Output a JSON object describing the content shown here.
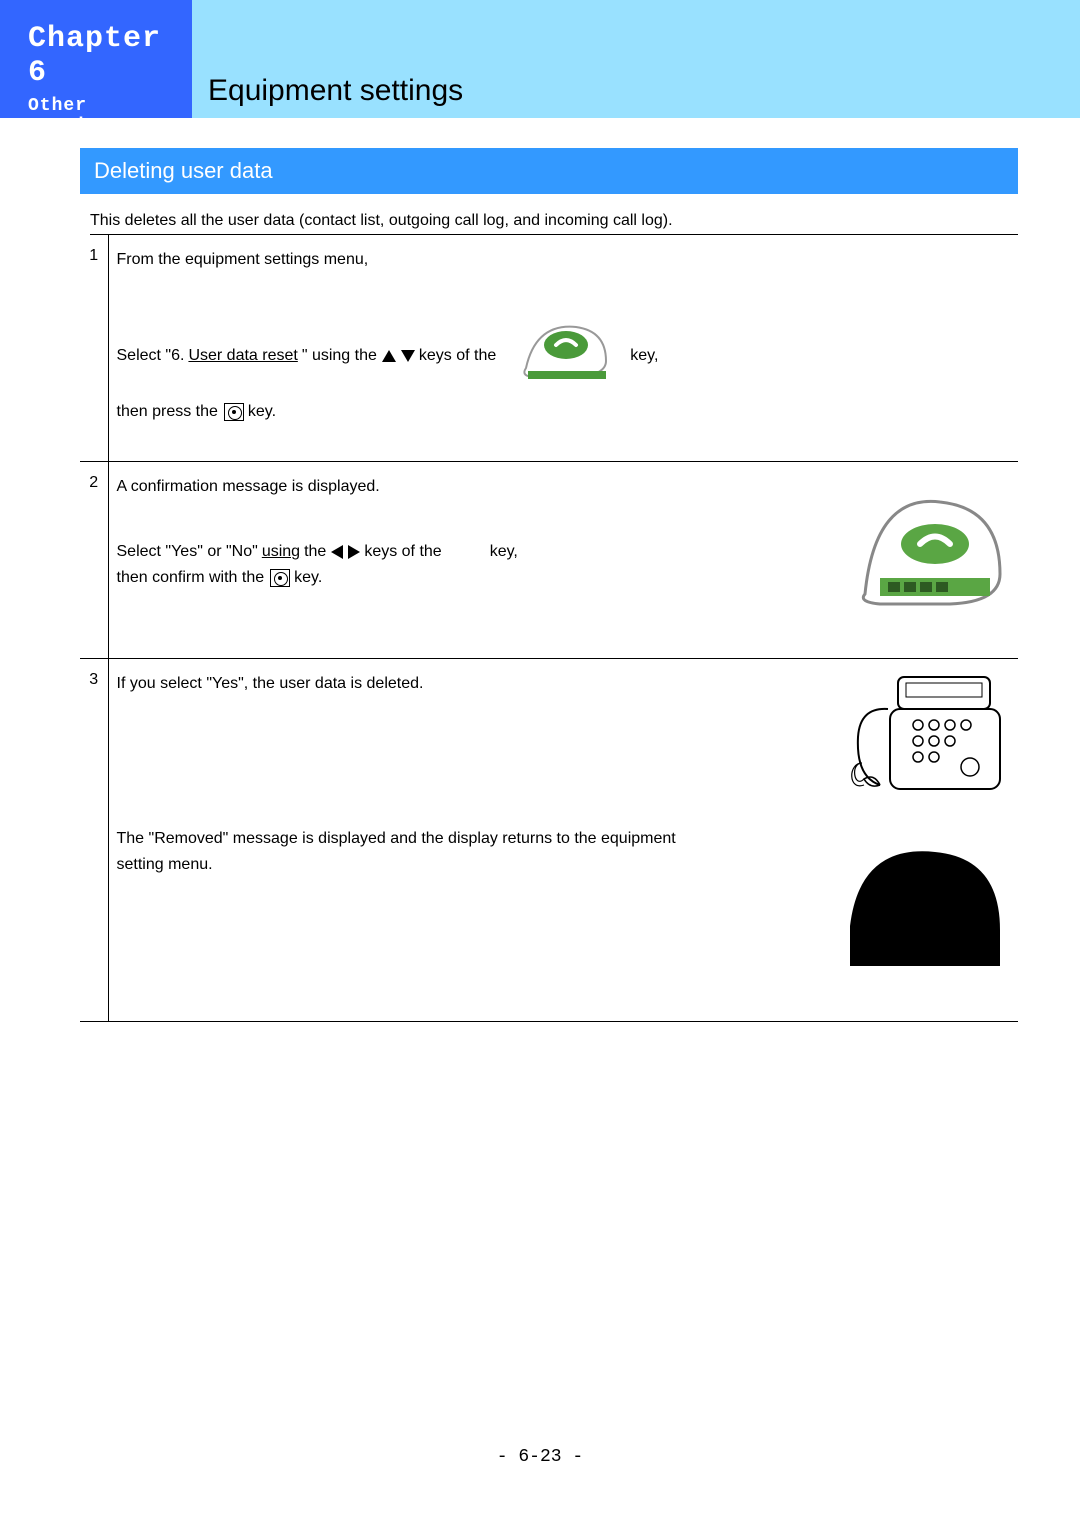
{
  "header": {
    "chapter_label": "Chapter 6",
    "chapter_sub": "Other settings",
    "section_title": "Equipment settings"
  },
  "subheading": "Deleting user data",
  "intro": "This deletes all the user data (contact list, outgoing call log, and incoming call log).",
  "steps": [
    {
      "num": "1",
      "line1": "From the equipment settings menu,",
      "line2a": "Select \"6. ",
      "line2b_underlined": "User data reset",
      "line2c": "\" using the ",
      "line2d": " keys of the ",
      "line2e": " key,",
      "line3a": "then press the ",
      "line3b": " key."
    },
    {
      "num": "2",
      "line1": "A confirmation message is displayed.",
      "line2a": "Select \"Yes\" or \"No\" ",
      "line2b_underlined": "using",
      "line2c": " the ",
      "line2d": " keys of the ",
      "line2e": " key,",
      "line3a": "then confirm with the ",
      "line3b": "  key."
    },
    {
      "num": "3",
      "line1": "If you select \"Yes\", the user data is deleted.",
      "line2": "The \"Removed\" message is displayed and the display returns to the equipment setting menu."
    }
  ],
  "footer": "- 6-23 -"
}
